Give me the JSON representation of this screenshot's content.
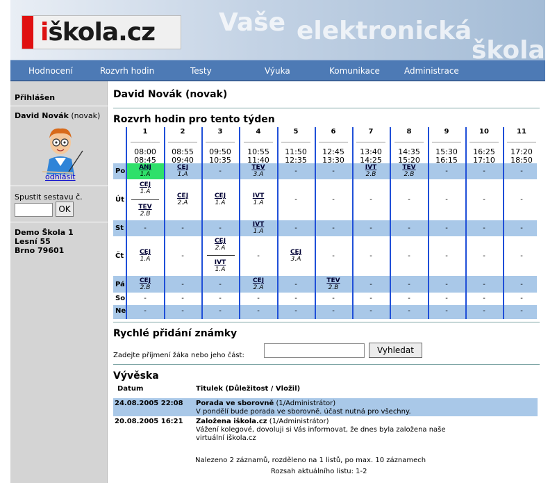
{
  "header": {
    "logo_prefix": "i",
    "logo_rest": "škola.cz",
    "watermark_1": "Vaše",
    "watermark_2": "elektronická",
    "watermark_3": "škola"
  },
  "nav": [
    "Hodnocení",
    "Rozvrh hodin",
    "Testy",
    "Výuka",
    "Komunikace",
    "Administrace"
  ],
  "sidebar": {
    "logged_in_label": "Přihlášen",
    "user_name": "David Novák",
    "user_login": "(novak)",
    "logout_label": "odhlásit",
    "report_label": "Spustit sestavu č.",
    "ok_label": "OK",
    "school": [
      "Demo Škola 1",
      "Lesní 55",
      "Brno 79601"
    ]
  },
  "main": {
    "title": "David Novák (novak)",
    "schedule_title": "Rozvrh hodin pro tento týden",
    "quick_grade_title": "Rychlé přidání známky",
    "quick_grade_label": "Zadejte příjmení žáka nebo jeho část:",
    "search_button": "Vyhledat",
    "board_title": "Vývěska",
    "board_col_date": "Datum",
    "board_col_title": "Titulek (Důležitost / Vložil)"
  },
  "timetable": {
    "periods": [
      {
        "num": "1",
        "start": "08:00",
        "end": "08:45"
      },
      {
        "num": "2",
        "start": "08:55",
        "end": "09:40"
      },
      {
        "num": "3",
        "start": "09:50",
        "end": "10:35"
      },
      {
        "num": "4",
        "start": "10:55",
        "end": "11:40"
      },
      {
        "num": "5",
        "start": "11:50",
        "end": "12:35"
      },
      {
        "num": "6",
        "start": "12:45",
        "end": "13:30"
      },
      {
        "num": "7",
        "start": "13:40",
        "end": "14:25"
      },
      {
        "num": "8",
        "start": "14:35",
        "end": "15:20"
      },
      {
        "num": "9",
        "start": "15:30",
        "end": "16:15"
      },
      {
        "num": "10",
        "start": "16:25",
        "end": "17:10"
      },
      {
        "num": "11",
        "start": "17:20",
        "end": "18:50"
      }
    ],
    "days": [
      "Po",
      "Út",
      "St",
      "Čt",
      "Pá",
      "So",
      "Ne"
    ],
    "empty": "-",
    "lessons": {
      "po_1": {
        "subject": "ANJ",
        "class": "1.A"
      },
      "po_2": {
        "subject": "CEJ",
        "class": "1.A"
      },
      "po_4": {
        "subject": "TEV",
        "class": "3.A"
      },
      "po_7": {
        "subject": "IVT",
        "class": "2.B"
      },
      "po_8": {
        "subject": "TEV",
        "class": "2.B"
      },
      "ut_1a": {
        "subject": "CEJ",
        "class": "1.A"
      },
      "ut_1b": {
        "subject": "TEV",
        "class": "2.B"
      },
      "ut_3": {
        "subject": "CEJ",
        "class": "2.A"
      },
      "ut_4": {
        "subject": "CEJ",
        "class": "1.A"
      },
      "ut_5": {
        "subject": "IVT",
        "class": "1.A"
      },
      "st_4": {
        "subject": "IVT",
        "class": "1.A"
      },
      "ct_1": {
        "subject": "CEJ",
        "class": "1.A"
      },
      "ct_3a": {
        "subject": "CEJ",
        "class": "2.A"
      },
      "ct_3b": {
        "subject": "IVT",
        "class": "1.A"
      },
      "ct_5": {
        "subject": "CEJ",
        "class": "3.A"
      },
      "pa_1": {
        "subject": "CEJ",
        "class": "2.B"
      },
      "pa_4": {
        "subject": "CEJ",
        "class": "2.A"
      },
      "pa_6": {
        "subject": "TEV",
        "class": "2.B"
      }
    }
  },
  "board": [
    {
      "date": "24.08.2005 22:08",
      "title": "Porada ve sborovně",
      "meta": "(1/Administrátor)",
      "text": [
        "V pondělí bude porada ve sborovně. účast nutná pro všechny."
      ]
    },
    {
      "date": "20.08.2005 16:21",
      "title": "Založena iškola.cz",
      "meta": "(1/Administrátor)",
      "text": [
        "Vážení kolegové, dovoluji si Vás informovat, že dnes byla založena naše",
        "virtuální iškola.cz"
      ]
    }
  ],
  "board_footer": {
    "found": "Nalezeno 2 záznamů, rozděleno na 1 listů, po max. 10 záznamech",
    "range": "Rozsah aktuálního listu: 1-2"
  }
}
